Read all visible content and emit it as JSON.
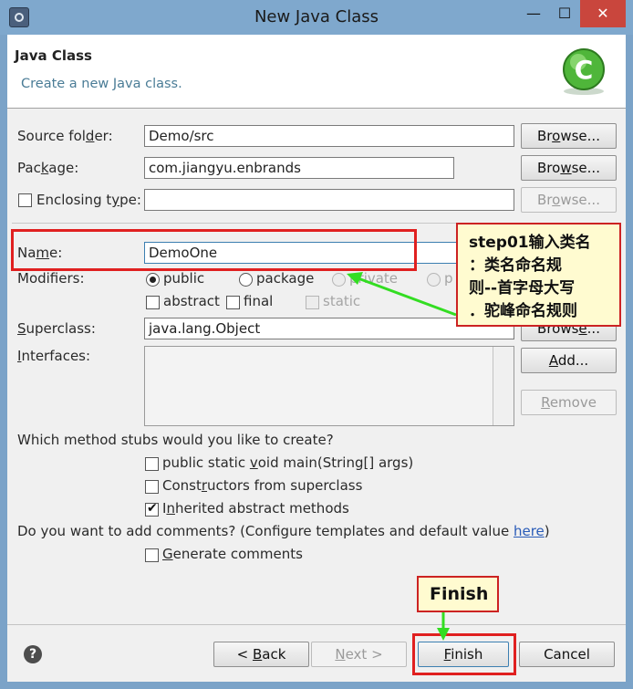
{
  "window": {
    "title": "New Java Class",
    "min": "—",
    "max": "☐",
    "close": "✕"
  },
  "header": {
    "title": "Java Class",
    "subtitle": "Create a new Java class."
  },
  "form": {
    "source_folder_label": "Source folder:",
    "source_folder_value": "Demo/src",
    "package_label": "Package:",
    "package_value": "com.jiangyu.enbrands",
    "enclosing_label": "Enclosing type:",
    "enclosing_value": "",
    "name_label": "Name:",
    "name_value": "DemoOne",
    "modifiers_label": "Modifiers:",
    "mod_public": "public",
    "mod_package": "package",
    "mod_private": "private",
    "mod_protected": "p",
    "mod_abstract": "abstract",
    "mod_final": "final",
    "mod_static": "static",
    "superclass_label": "Superclass:",
    "superclass_value": "java.lang.Object",
    "interfaces_label": "Interfaces:",
    "browse": "Browse...",
    "add": "Add...",
    "remove": "Remove"
  },
  "stubs": {
    "question": "Which method stubs would you like to create?",
    "main": "public static void main(String[] args)",
    "constructors": "Constructors from superclass",
    "inherited": "Inherited abstract methods"
  },
  "comments": {
    "question_prefix": "Do you want to add comments? (Configure templates and default value ",
    "link": "here",
    "question_suffix": ")",
    "generate": "Generate comments"
  },
  "footer": {
    "help": "?",
    "back": "< Back",
    "next": "Next >",
    "finish": "Finish",
    "cancel": "Cancel"
  },
  "annotations": {
    "step_lines": [
      "step01输入类名",
      "：类名命名规",
      "则--首字母大写",
      "．驼峰命名规则"
    ],
    "finish_callout": "Finish"
  },
  "colors": {
    "accent_red": "#e02020",
    "arrow_green": "#33dd22",
    "callout_bg": "#fffbd0"
  }
}
